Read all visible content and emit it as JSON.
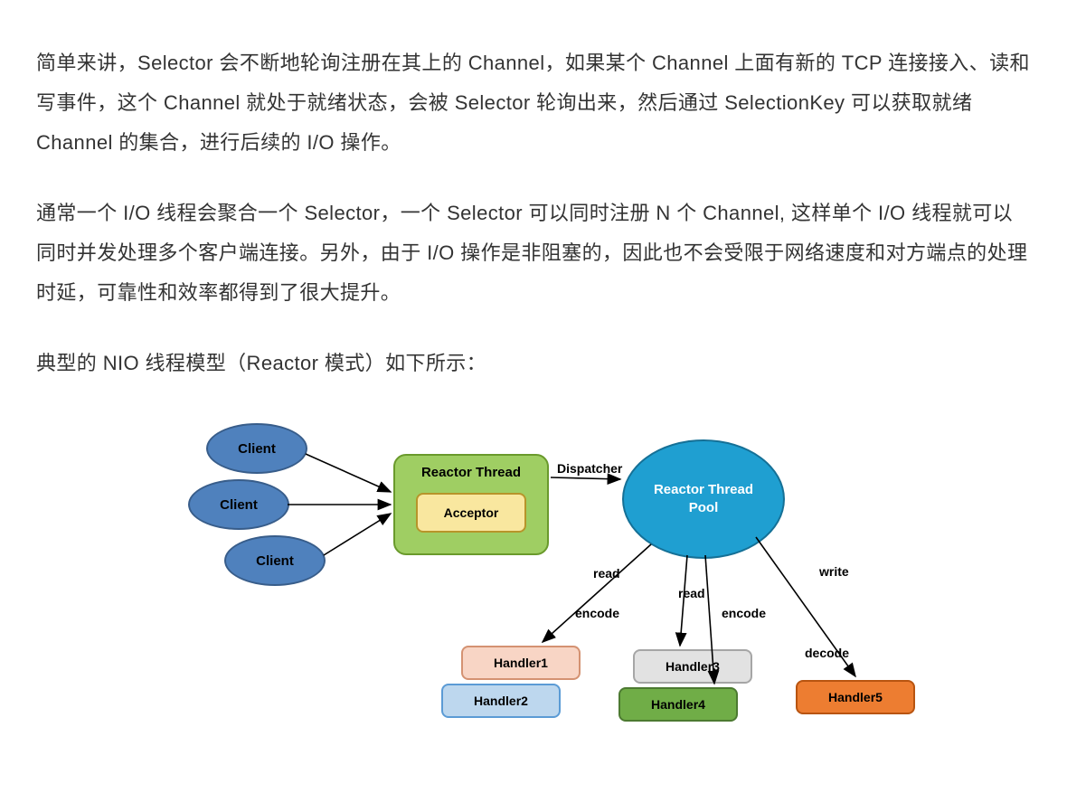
{
  "paragraphs": {
    "p1": "简单来讲，Selector 会不断地轮询注册在其上的 Channel，如果某个 Channel 上面有新的 TCP 连接接入、读和写事件，这个 Channel 就处于就绪状态，会被 Selector 轮询出来，然后通过 SelectionKey 可以获取就绪 Channel 的集合，进行后续的 I/O 操作。",
    "p2": "通常一个 I/O 线程会聚合一个 Selector，一个 Selector 可以同时注册 N 个 Channel, 这样单个 I/O 线程就可以同时并发处理多个客户端连接。另外，由于 I/O 操作是非阻塞的，因此也不会受限于网络速度和对方端点的处理时延，可靠性和效率都得到了很大提升。",
    "p3": "典型的 NIO 线程模型（Reactor 模式）如下所示："
  },
  "diagram": {
    "clients": [
      "Client",
      "Client",
      "Client"
    ],
    "reactor_label": "Reactor Thread",
    "acceptor_label": "Acceptor",
    "pool_label": "Reactor Thread\nPool",
    "dispatcher_label": "Dispatcher",
    "edge_labels": {
      "read1": "read",
      "encode1": "encode",
      "read2": "read",
      "encode2": "encode",
      "write": "write",
      "decode": "decode"
    },
    "handlers": [
      {
        "label": "Handler1",
        "fill": "#f8d5c5",
        "stroke": "#d49272"
      },
      {
        "label": "Handler2",
        "fill": "#bdd7ee",
        "stroke": "#5b9bd5"
      },
      {
        "label": "Handler3",
        "fill": "#e2e2e2",
        "stroke": "#a6a6a6"
      },
      {
        "label": "Handler4",
        "fill": "#70ad47",
        "stroke": "#4c7a31"
      },
      {
        "label": "Handler5",
        "fill": "#ed7d31",
        "stroke": "#b85410"
      }
    ]
  }
}
